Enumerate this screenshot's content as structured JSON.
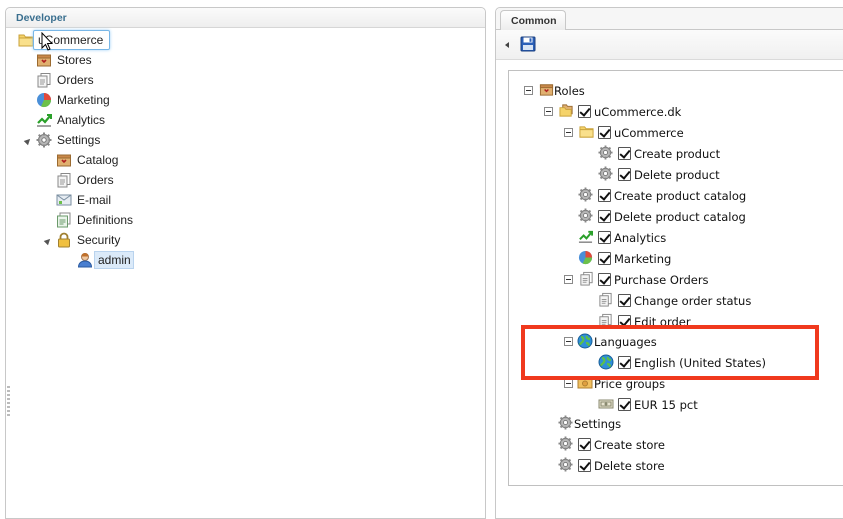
{
  "left_panel": {
    "header": "Developer",
    "tree": {
      "root": "uCommerce",
      "stores": "Stores",
      "orders": "Orders",
      "marketing": "Marketing",
      "analytics": "Analytics",
      "settings": "Settings",
      "catalog": "Catalog",
      "settings_orders": "Orders",
      "email": "E-mail",
      "definitions": "Definitions",
      "security": "Security",
      "admin": "admin"
    }
  },
  "right_panel": {
    "tab": "Common",
    "roles": {
      "root": "Roles",
      "store": "uCommerce.dk",
      "catalog": "uCommerce",
      "create_product": "Create product",
      "delete_product": "Delete product",
      "create_catalog": "Create product catalog",
      "delete_catalog": "Delete product catalog",
      "analytics": "Analytics",
      "marketing": "Marketing",
      "purchase_orders": "Purchase Orders",
      "change_status": "Change order status",
      "edit_order": "Edit order",
      "languages": "Languages",
      "english": "English (United States)",
      "price_groups": "Price groups",
      "eur": "EUR 15 pct",
      "settings": "Settings",
      "create_store": "Create store",
      "delete_store": "Delete store"
    }
  },
  "colors": {
    "header_text": "#3a6f8f",
    "highlight": "#f0391d",
    "selection": "#dbeaf9"
  }
}
